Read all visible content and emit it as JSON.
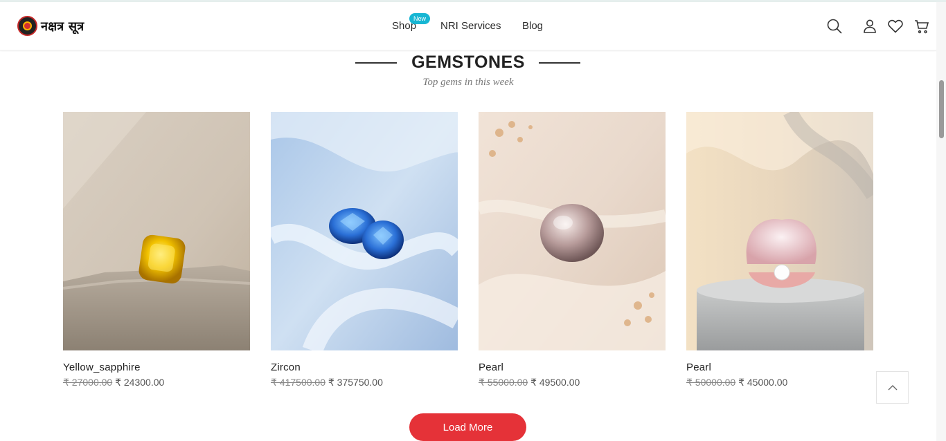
{
  "header": {
    "logo_text": "नक्षत्र सूत्र",
    "nav": {
      "shop": "Shop",
      "shop_badge": "New",
      "nri": "NRI Services",
      "blog": "Blog"
    },
    "icons": [
      "search-icon",
      "user-icon",
      "heart-icon",
      "cart-icon"
    ]
  },
  "section": {
    "title": "GEMSTONES",
    "subtitle": "Top gems in this week"
  },
  "products": [
    {
      "name": "Yellow_sapphire",
      "old_price": "₹ 27000.00",
      "price": "₹ 24300.00"
    },
    {
      "name": "Zircon",
      "old_price": "₹ 417500.00",
      "price": "₹ 375750.00"
    },
    {
      "name": "Pearl",
      "old_price": "₹ 55000.00",
      "price": "₹ 49500.00"
    },
    {
      "name": "Pearl",
      "old_price": "₹ 50000.00",
      "price": "₹ 45000.00"
    }
  ],
  "load_more": "Load More",
  "colors": {
    "accent": "#e53238",
    "badge": "#17b6d3"
  }
}
